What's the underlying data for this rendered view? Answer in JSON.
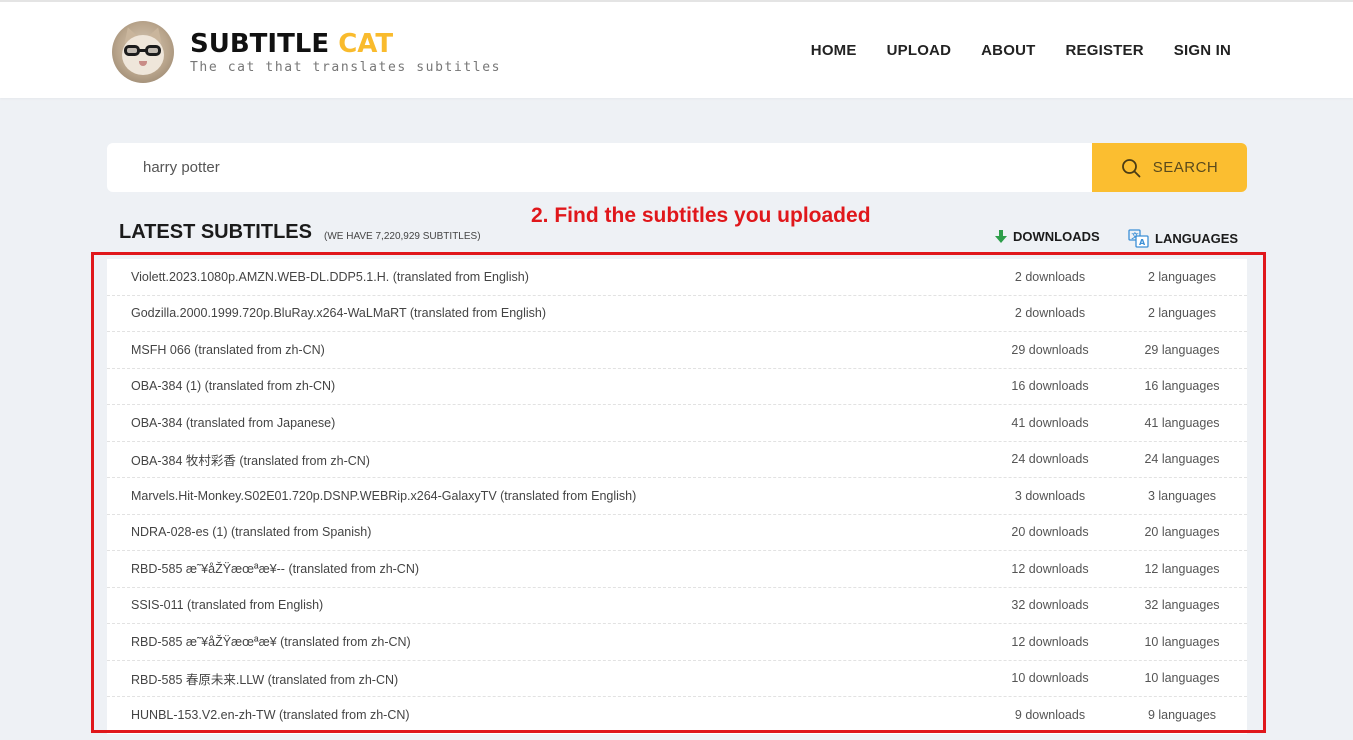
{
  "brand": {
    "name_main": "SUBTITLE ",
    "name_accent": "CAT",
    "tagline": "The cat that translates subtitles"
  },
  "nav": [
    {
      "label": "HOME"
    },
    {
      "label": "UPLOAD"
    },
    {
      "label": "ABOUT"
    },
    {
      "label": "REGISTER"
    },
    {
      "label": "SIGN IN"
    }
  ],
  "search": {
    "value": "harry potter",
    "button_label": "SEARCH"
  },
  "annotation": "2. Find the subtitles you uploaded",
  "latest": {
    "title": "LATEST SUBTITLES",
    "count": "(WE HAVE 7,220,929 SUBTITLES)",
    "downloads_header": "DOWNLOADS",
    "languages_header": "LANGUAGES"
  },
  "rows": [
    {
      "name": "Violett.2023.1080p.AMZN.WEB-DL.DDP5.1.H. (translated from English)",
      "downloads": "2 downloads",
      "languages": "2 languages"
    },
    {
      "name": "Godzilla.2000.1999.720p.BluRay.x264-WaLMaRT (translated from English)",
      "downloads": "2 downloads",
      "languages": "2 languages"
    },
    {
      "name": "MSFH 066 (translated from zh-CN)",
      "downloads": "29 downloads",
      "languages": "29 languages"
    },
    {
      "name": "OBA-384 (1) (translated from zh-CN)",
      "downloads": "16 downloads",
      "languages": "16 languages"
    },
    {
      "name": "OBA-384 (translated from Japanese)",
      "downloads": "41 downloads",
      "languages": "41 languages"
    },
    {
      "name": "OBA-384 牧村彩香 (translated from zh-CN)",
      "downloads": "24 downloads",
      "languages": "24 languages"
    },
    {
      "name": "Marvels.Hit-Monkey.S02E01.720p.DSNP.WEBRip.x264-GalaxyTV (translated from English)",
      "downloads": "3 downloads",
      "languages": "3 languages"
    },
    {
      "name": "NDRA-028-es (1) (translated from Spanish)",
      "downloads": "20 downloads",
      "languages": "20 languages"
    },
    {
      "name": "RBD-585 æ˜¥åŽŸæœªæ¥-- (translated from zh-CN)",
      "downloads": "12 downloads",
      "languages": "12 languages"
    },
    {
      "name": "SSIS-011 (translated from English)",
      "downloads": "32 downloads",
      "languages": "32 languages"
    },
    {
      "name": "RBD-585 æ˜¥åŽŸæœªæ¥ (translated from zh-CN)",
      "downloads": "12 downloads",
      "languages": "10 languages"
    },
    {
      "name": "RBD-585 春原未来.LLW (translated from zh-CN)",
      "downloads": "10 downloads",
      "languages": "10 languages"
    },
    {
      "name": "HUNBL-153.V2.en-zh-TW (translated from zh-CN)",
      "downloads": "9 downloads",
      "languages": "9 languages"
    }
  ],
  "colors": {
    "accent": "#fbbe30",
    "annotation_red": "#e0171b",
    "download_arrow": "#2e9e4a"
  },
  "icons": {
    "search": "magnifier-icon",
    "downloads": "down-arrow-icon",
    "languages": "translate-icon",
    "logo": "cat-logo-icon"
  }
}
